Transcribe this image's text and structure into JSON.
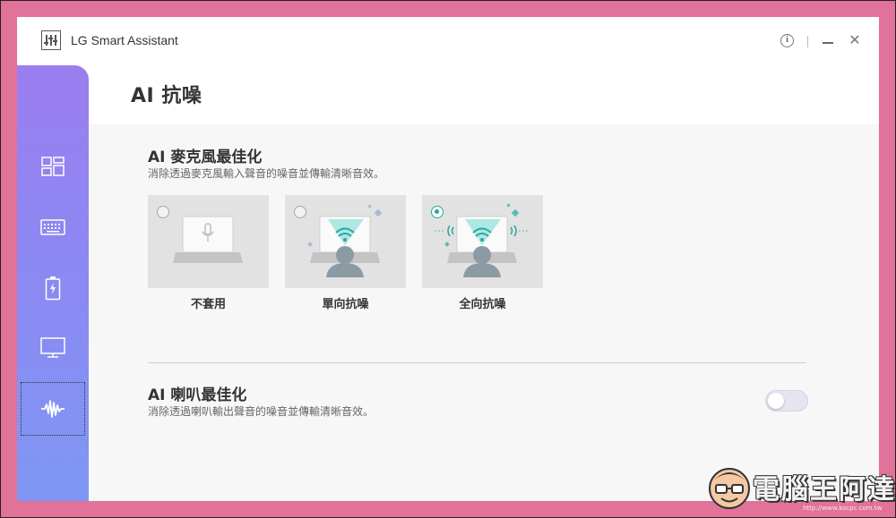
{
  "app": {
    "title": "LG Smart Assistant"
  },
  "window_controls": {
    "info": "i",
    "close": "✕"
  },
  "sidebar": {
    "items": [
      {
        "name": "dashboard",
        "icon": "dashboard-grid-icon",
        "active": false
      },
      {
        "name": "keyboard",
        "icon": "keyboard-icon",
        "active": false
      },
      {
        "name": "battery",
        "icon": "battery-charging-icon",
        "active": false
      },
      {
        "name": "display",
        "icon": "monitor-icon",
        "active": false
      },
      {
        "name": "ai-noise",
        "icon": "sound-wave-icon",
        "active": true
      }
    ]
  },
  "page": {
    "title": "AI 抗噪"
  },
  "mic_section": {
    "title": "AI 麥克風最佳化",
    "description": "消除透過麥克風輸入聲音的噪音並傳輸清晰音效。",
    "options": [
      {
        "label": "不套用",
        "selected": false
      },
      {
        "label": "單向抗噪",
        "selected": false
      },
      {
        "label": "全向抗噪",
        "selected": true
      }
    ]
  },
  "speaker_section": {
    "title": "AI 喇叭最佳化",
    "description": "消除透過喇叭輸出聲音的噪音並傳輸清晰音效。",
    "toggle_on": false
  },
  "watermark": {
    "text": "電腦王阿達",
    "url": "http://www.kocpc.com.tw"
  },
  "colors": {
    "accent": "#2aa6a0",
    "sidebar_top": "#9b7ef0",
    "sidebar_bottom": "#7f97f4",
    "background": "#e1729a"
  }
}
